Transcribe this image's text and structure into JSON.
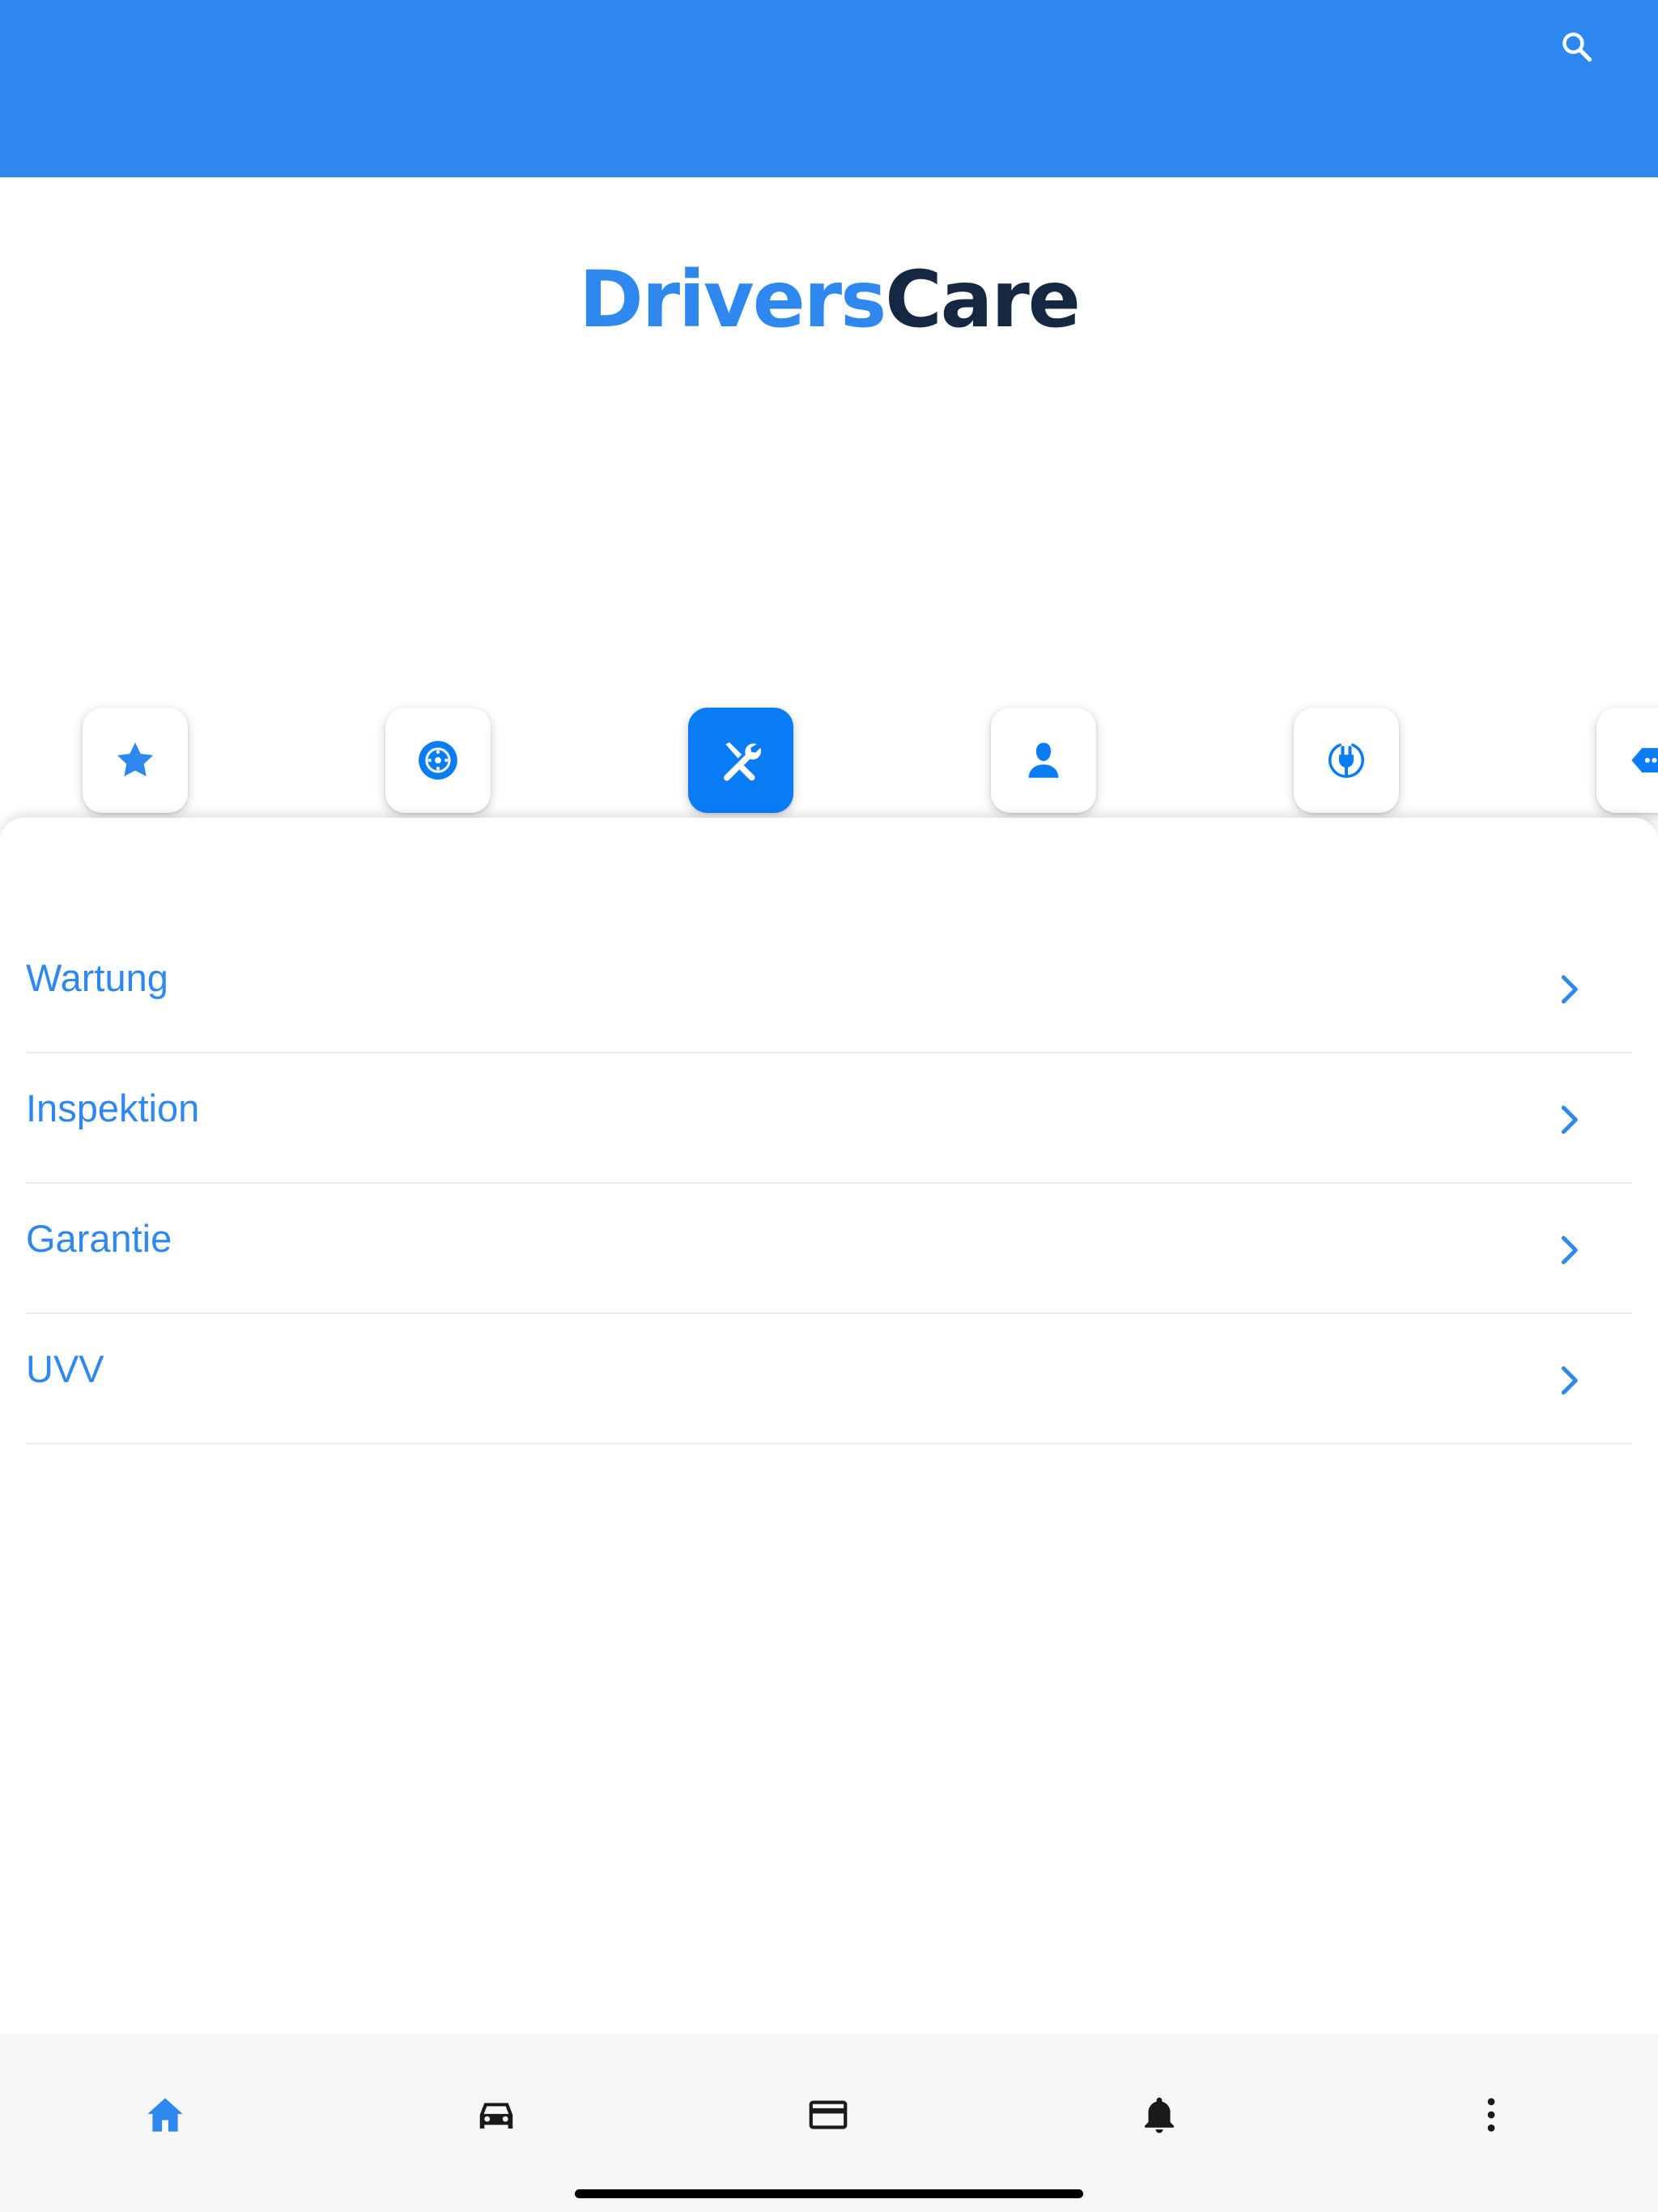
{
  "header": {
    "search_icon": "search-icon",
    "color": "#2f88f0"
  },
  "logo": {
    "part1": "Drivers",
    "part2": "Care",
    "primary_color": "#2f88f0",
    "secondary_color": "#162742"
  },
  "categories": [
    {
      "icon": "star-icon",
      "active": false
    },
    {
      "icon": "tire-icon",
      "active": false
    },
    {
      "icon": "wrench-screwdriver-icon",
      "active": true
    },
    {
      "icon": "person-icon",
      "active": false
    },
    {
      "icon": "ev-plug-icon",
      "active": false
    },
    {
      "icon": "tag-icon",
      "active": false
    }
  ],
  "menu": {
    "items": [
      {
        "label": "Wartung"
      },
      {
        "label": "Inspektion"
      },
      {
        "label": "Garantie"
      },
      {
        "label": "UVV"
      }
    ],
    "accent": "#2f88f0"
  },
  "tabbar": {
    "tabs": [
      {
        "icon": "home-icon",
        "active": true
      },
      {
        "icon": "car-icon",
        "active": false
      },
      {
        "icon": "credit-card-icon",
        "active": false
      },
      {
        "icon": "bell-icon",
        "active": false
      },
      {
        "icon": "more-vertical-icon",
        "active": false
      }
    ]
  }
}
